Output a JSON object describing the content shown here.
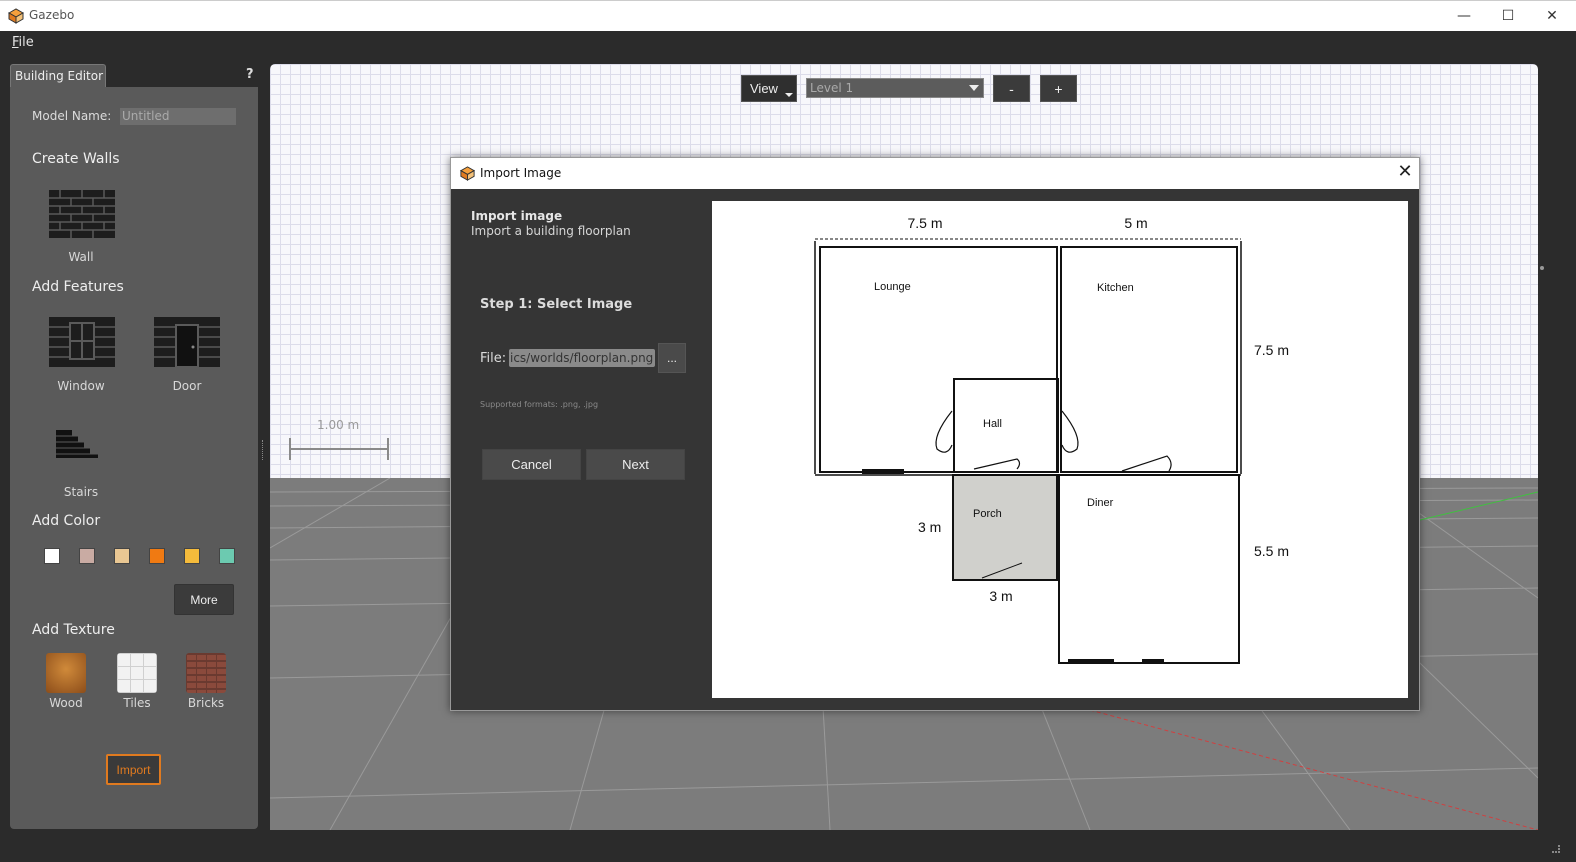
{
  "window": {
    "title": "Gazebo",
    "controls": {
      "minimize": "—",
      "maximize": "☐",
      "close": "✕"
    }
  },
  "menu": {
    "file_underlined": "F",
    "file_rest": "ile"
  },
  "editor": {
    "tab_label": "Building Editor",
    "help_label": "?",
    "model_name_label": "Model Name:",
    "model_name_value": "Untitled",
    "create_walls": "Create Walls",
    "wall_label": "Wall",
    "add_features": "Add Features",
    "window_label": "Window",
    "door_label": "Door",
    "stairs_label": "Stairs",
    "add_color": "Add Color",
    "colors": [
      "#ffffff",
      "#c9aba3",
      "#e9c793",
      "#f07a12",
      "#f5bb3b",
      "#6ccab0"
    ],
    "more_label": "More",
    "add_texture": "Add Texture",
    "textures": [
      "Wood",
      "Tiles",
      "Bricks"
    ],
    "import_label": "Import"
  },
  "view": {
    "view_button": "View",
    "level": "Level 1",
    "zoom_out": "-",
    "zoom_in": "+",
    "scale": "1.00 m"
  },
  "dialog": {
    "title": "Import Image",
    "heading": "Import image",
    "subheading": "Import a building floorplan",
    "step": "Step 1: Select Image",
    "file_label": "File:",
    "file_value": "ics/worlds/floorplan.png",
    "browse_label": "...",
    "formats": "Supported formats: .png, .jpg",
    "cancel_label": "Cancel",
    "next_label": "Next",
    "close_glyph": "✕"
  },
  "floorplan": {
    "dims": {
      "top_left": "7.5 m",
      "top_right": "5 m",
      "right_upper": "7.5 m",
      "right_lower": "5.5 m",
      "porch_side": "3 m",
      "porch_bottom": "3 m"
    },
    "rooms": {
      "lounge": "Lounge",
      "kitchen": "Kitchen",
      "hall": "Hall",
      "porch": "Porch",
      "diner": "Diner"
    }
  }
}
